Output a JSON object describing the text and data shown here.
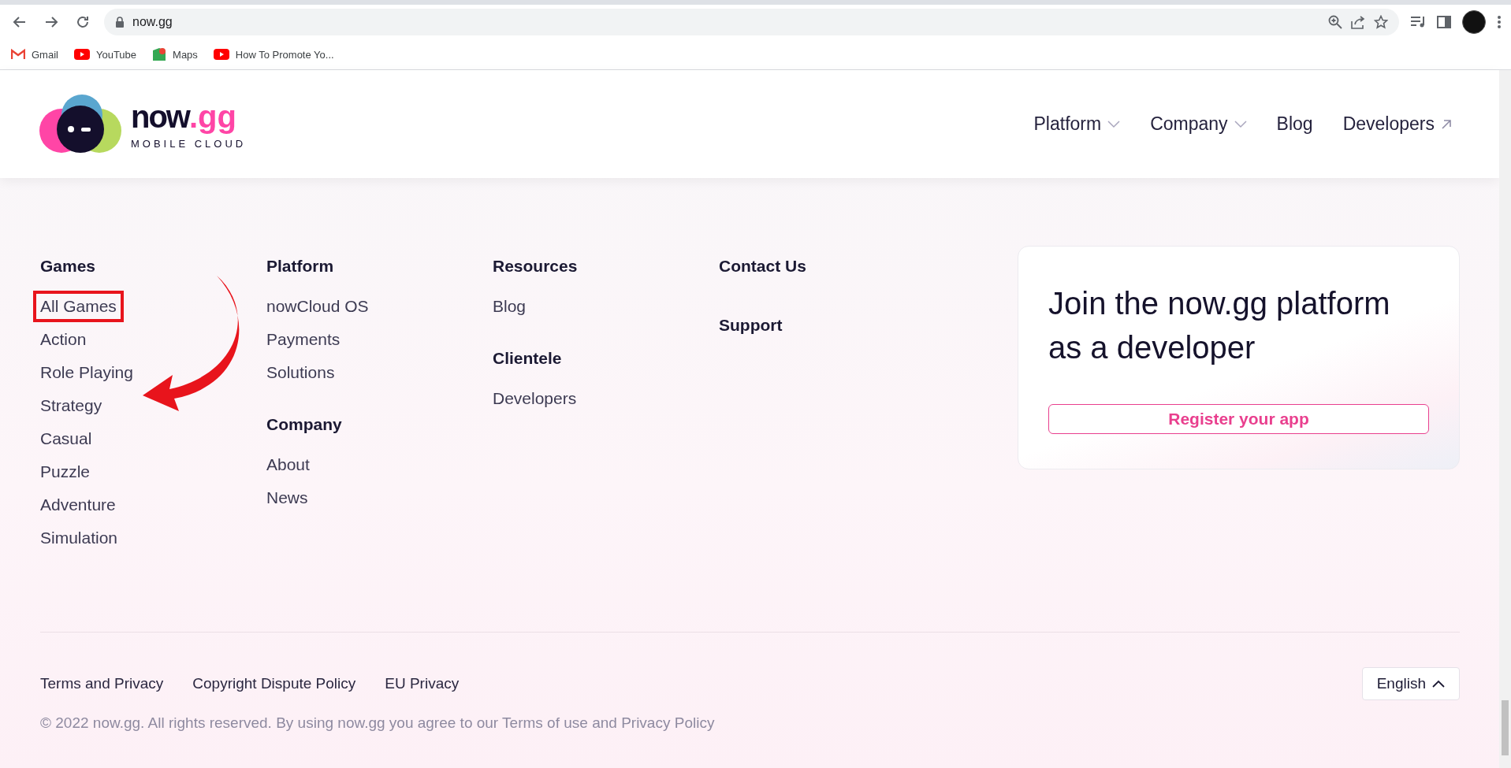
{
  "browser": {
    "url": "now.gg",
    "bookmarks": [
      {
        "label": "Gmail",
        "kind": "gmail"
      },
      {
        "label": "YouTube",
        "kind": "youtube"
      },
      {
        "label": "Maps",
        "kind": "maps"
      },
      {
        "label": "How To Promote Yo...",
        "kind": "youtube"
      }
    ]
  },
  "header": {
    "logo": {
      "word": "now",
      "suffix": ".gg",
      "tagline": "MOBILE CLOUD"
    },
    "nav": [
      {
        "label": "Platform",
        "kind": "dropdown"
      },
      {
        "label": "Company",
        "kind": "dropdown"
      },
      {
        "label": "Blog",
        "kind": "link"
      },
      {
        "label": "Developers",
        "kind": "external"
      }
    ]
  },
  "footer_columns": [
    {
      "groups": [
        {
          "heading": "Games",
          "items": [
            {
              "label": "All Games",
              "highlighted": true
            },
            {
              "label": "Action",
              "highlighted": false
            },
            {
              "label": "Role Playing",
              "highlighted": false
            },
            {
              "label": "Strategy",
              "highlighted": false
            },
            {
              "label": "Casual",
              "highlighted": false
            },
            {
              "label": "Puzzle",
              "highlighted": false
            },
            {
              "label": "Adventure",
              "highlighted": false
            },
            {
              "label": "Simulation",
              "highlighted": false
            }
          ]
        }
      ]
    },
    {
      "groups": [
        {
          "heading": "Platform",
          "items": [
            {
              "label": "nowCloud OS",
              "highlighted": false
            },
            {
              "label": "Payments",
              "highlighted": false
            },
            {
              "label": "Solutions",
              "highlighted": false
            }
          ]
        },
        {
          "heading": "Company",
          "items": [
            {
              "label": "About",
              "highlighted": false
            },
            {
              "label": "News",
              "highlighted": false
            }
          ]
        }
      ]
    },
    {
      "groups": [
        {
          "heading": "Resources",
          "items": [
            {
              "label": "Blog",
              "highlighted": false
            }
          ]
        },
        {
          "heading": "Clientele",
          "items": [
            {
              "label": "Developers",
              "highlighted": false
            }
          ]
        }
      ]
    },
    {
      "groups": [
        {
          "heading": "Contact Us"
        },
        {
          "heading": "Support"
        }
      ]
    }
  ],
  "developer_card": {
    "title": "Join the now.gg platform as a developer",
    "button": "Register your app"
  },
  "bottom_links": [
    "Terms and Privacy",
    "Copyright Dispute Policy",
    "EU Privacy"
  ],
  "language": "English",
  "copyright": "© 2022 now.gg. All rights reserved. By using now.gg you agree to our Terms of use and Privacy Policy"
}
